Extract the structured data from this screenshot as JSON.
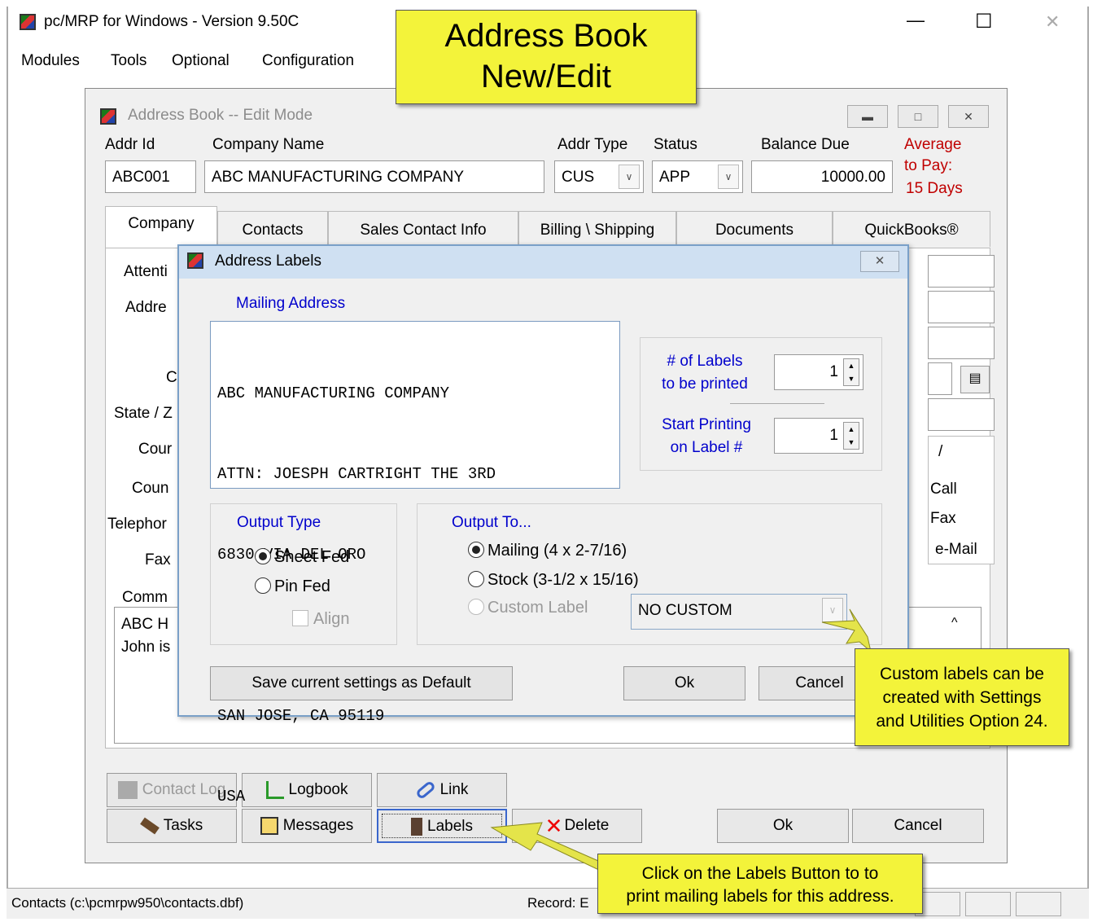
{
  "app": {
    "title": "pc/MRP for Windows - Version 9.50C",
    "minimize_glyph": "—",
    "maximize_glyph": "☐",
    "close_glyph": "✕"
  },
  "menu": {
    "modules": "Modules",
    "tools": "Tools",
    "optional": "Optional",
    "configuration": "Configuration"
  },
  "title_callout": {
    "line1": "Address Book",
    "line2": "New/Edit"
  },
  "address_book": {
    "title": "Address Book -- Edit Mode",
    "labels": {
      "addr_id": "Addr Id",
      "company_name": "Company Name",
      "addr_type": "Addr Type",
      "status": "Status",
      "balance_due": "Balance Due",
      "avg_pay_1": "Average",
      "avg_pay_2": "to Pay:",
      "avg_pay_3": "15 Days"
    },
    "values": {
      "addr_id": "ABC001",
      "company_name": "ABC MANUFACTURING COMPANY",
      "addr_type": "CUS",
      "status": "APP",
      "balance_due": "10000.00"
    },
    "tabs": [
      "Company",
      "Contacts",
      "Sales Contact Info",
      "Billing \\ Shipping",
      "Documents",
      "QuickBooks®"
    ],
    "partial_labels": {
      "attention": "Attenti",
      "address": "Addre",
      "city": "C",
      "state": "State / Z",
      "county": "Cour",
      "country": "Coun",
      "telephone": "Telephor",
      "fax": "Fax",
      "comments": "Comm",
      "comment_line1": "ABC H",
      "comment_line2": "John is"
    },
    "side_labels": {
      "slash": "/",
      "call": "Call",
      "fax": "Fax",
      "email": "e-Mail",
      "scroll_up": "^"
    },
    "buttons": {
      "contact_log": "Contact Log",
      "logbook": "Logbook",
      "link": "Link",
      "tasks": "Tasks",
      "messages": "Messages",
      "labels": "Labels",
      "delete": "Delete",
      "ok": "Ok",
      "cancel": "Cancel"
    }
  },
  "labels_dialog": {
    "title": "Address Labels",
    "mailing_address_label": "Mailing Address",
    "mailing_address_lines": [
      "ABC MANUFACTURING COMPANY",
      "ATTN: JOESPH CARTRIGHT THE 3RD",
      "6830 VIA DEL ORO",
      "",
      "SAN JOSE, CA 95119",
      "USA"
    ],
    "num_labels_1": "# of Labels",
    "num_labels_2": "to be printed",
    "num_labels_value": "1",
    "start_label_1": "Start Printing",
    "start_label_2": "on Label #",
    "start_label_value": "1",
    "output_type_label": "Output Type",
    "output_type_options": {
      "sheet_fed": "Sheet Fed",
      "pin_fed": "Pin Fed"
    },
    "output_type_selected": "sheet_fed",
    "align_label": "Align",
    "output_to_label": "Output To...",
    "output_to_options": {
      "mailing": "Mailing (4 x 2-7/16)",
      "stock": "Stock (3-1/2 x 15/16)",
      "custom": "Custom Label"
    },
    "output_to_selected": "mailing",
    "custom_select_value": "NO CUSTOM",
    "save_default_button": "Save current settings as Default",
    "ok_button": "Ok",
    "cancel_button": "Cancel",
    "close_glyph": "✕"
  },
  "callouts": {
    "custom_line1": "Custom labels can be",
    "custom_line2": "created with Settings",
    "custom_line3": "and Utilities Option 24.",
    "labels_line1": "Click on the Labels Button to to",
    "labels_line2": "print mailing labels for this address."
  },
  "status_bar": {
    "path": "Contacts (c:\\pcmrpw950\\contacts.dbf)",
    "record": "Record: E"
  },
  "colors": {
    "callout_yellow": "#f3f33a",
    "dialog_blue_text": "#0000cc",
    "red_text": "#c00000",
    "arrow_yellow": "#e4e44a"
  }
}
